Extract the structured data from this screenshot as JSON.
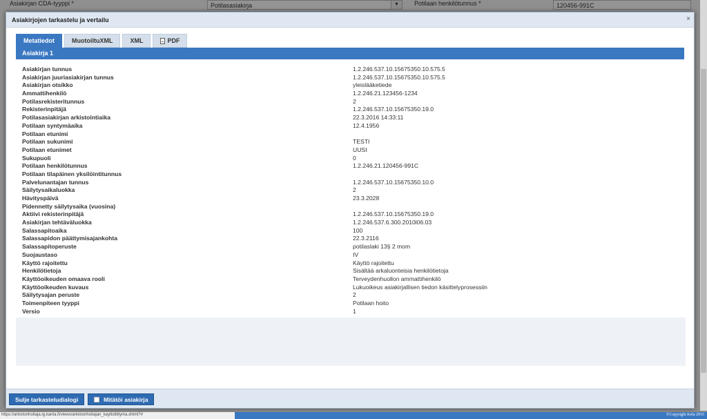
{
  "background": {
    "label_left": "Asiakirjan CDA-tyyppi *",
    "select_value": "Potilasasiakirja",
    "label_right": "Potilaan henkilötunnus *",
    "input_value": "120456-991C"
  },
  "dialog": {
    "title": "Asiakirjojen tarkastelu ja vertailu",
    "close_glyph": "×",
    "tabs": [
      {
        "label": "Metatiedot",
        "active": true
      },
      {
        "label": "MuotoiltuXML",
        "active": false
      },
      {
        "label": "XML",
        "active": false
      },
      {
        "label": "PDF",
        "active": false
      }
    ],
    "section_title": "Asiakirja 1",
    "rows": [
      {
        "label": "Asiakirjan tunnus",
        "value": "1.2.246.537.10.15675350.10.575.5"
      },
      {
        "label": "Asiakirjan juuriasiakirjan tunnus",
        "value": "1.2.246.537.10.15675350.10.575.5"
      },
      {
        "label": "Asiakirjan otsikko",
        "value": "yleislääketiede"
      },
      {
        "label": "Ammattihenkilö",
        "value": "1.2.246.21.123456-1234"
      },
      {
        "label": "Potilasrekisteritunnus",
        "value": "2"
      },
      {
        "label": "Rekisterinpitäjä",
        "value": "1.2.246.537.10.15675350.19.0"
      },
      {
        "label": "Potilasasiakirjan arkistointiaika",
        "value": "22.3.2016 14:33:11"
      },
      {
        "label": "Potilaan syntymäaika",
        "value": "12.4.1956"
      },
      {
        "label": "Potilaan etunimi",
        "value": ""
      },
      {
        "label": "Potilaan sukunimi",
        "value": "TESTI"
      },
      {
        "label": "Potilaan etunimet",
        "value": "UUSI"
      },
      {
        "label": "Sukupuoli",
        "value": "0"
      },
      {
        "label": "Potilaan henkilötunnus",
        "value": "1.2.246.21.120456-991C"
      },
      {
        "label": "Potilaan tilapäinen yksilöintitunnus",
        "value": ""
      },
      {
        "label": "Palvelunantajan tunnus",
        "value": "1.2.246.537.10.15675350.10.0"
      },
      {
        "label": "Säilytysaikaluokka",
        "value": "2"
      },
      {
        "label": "Hävityspäivä",
        "value": "23.3.2028"
      },
      {
        "label": "Pidennetty säilytysaika (vuosina)",
        "value": ""
      },
      {
        "label": "Aktiivi rekisterinpitäjä",
        "value": "1.2.246.537.10.15675350.19.0"
      },
      {
        "label": "Asiakirjan tehtäväluokka",
        "value": "1.2.246.537.6.300.2010l06.03"
      },
      {
        "label": "Salassapitoaika",
        "value": "100"
      },
      {
        "label": "Salassapidon päättymisajankohta",
        "value": "22.3.2116"
      },
      {
        "label": "Salassapitoperuste",
        "value": "potilaslaki 13§ 2 mom"
      },
      {
        "label": "Suojaustaso",
        "value": "IV"
      },
      {
        "label": "Käyttö rajoitettu",
        "value": "Käyttö rajoitettu"
      },
      {
        "label": "Henkilötietoja",
        "value": "Sisältää arkaluonteisia henkilötietoja"
      },
      {
        "label": "Käyttöoikeuden omaava rooli",
        "value": "Terveydenhuollon ammattihenkilö"
      },
      {
        "label": "Käyttöoikeuden kuvaus",
        "value": "Lukuoikeus asiakirjallisen tiedon käsittelyprosessiin"
      },
      {
        "label": "Säilytysajan peruste",
        "value": "2"
      },
      {
        "label": "Toimenpiteen tyyppi",
        "value": "Potilaan hoito"
      },
      {
        "label": "Versio",
        "value": "1"
      }
    ],
    "footer": {
      "close_button": "Sulje tarkasteludialogi",
      "void_button": "Mitätöi asiakirja"
    }
  },
  "status": {
    "url": "https://arkistonhoitaja.ig.kanta.fi/views/arkistonhoitajan_kayttoliittyma.xhtml?#",
    "copyright": "©Copyright Kela 2015"
  }
}
